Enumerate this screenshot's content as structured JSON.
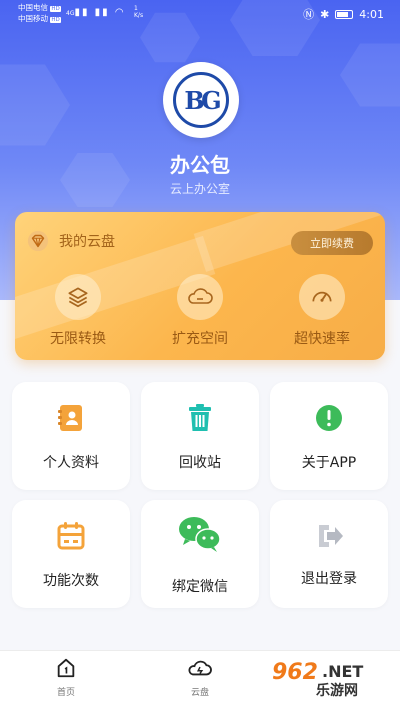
{
  "status_bar": {
    "carrier1": "中国电信",
    "carrier2": "中国移动",
    "net_badge": "HD",
    "net_type": "4G",
    "rate_top": "1",
    "rate_unit": "K/s",
    "time": "4:01",
    "battery_icon": "battery-icon"
  },
  "profile": {
    "logo_text": "BG",
    "app_name": "办公包",
    "subtitle": "云上办公室"
  },
  "vip_card": {
    "title": "我的云盘",
    "renew_label": "立即续费",
    "features": [
      {
        "label": "无限转换",
        "icon": "layers-icon"
      },
      {
        "label": "扩充空间",
        "icon": "cloud-icon"
      },
      {
        "label": "超快速率",
        "icon": "speedometer-icon"
      }
    ],
    "colors": {
      "gold": "#fcb64d",
      "text": "#9a5a14"
    }
  },
  "tiles": [
    {
      "label": "个人资料",
      "icon": "contacts-book-icon"
    },
    {
      "label": "回收站",
      "icon": "trash-icon"
    },
    {
      "label": "关于APP",
      "icon": "info-icon"
    },
    {
      "label": "功能次数",
      "icon": "calendar-icon"
    },
    {
      "label": "绑定微信",
      "icon": "wechat-icon"
    },
    {
      "label": "退出登录",
      "icon": "logout-icon"
    }
  ],
  "bottom_nav": {
    "items": [
      {
        "label": "首页",
        "icon": "home-icon"
      },
      {
        "label": "云盘",
        "icon": "cloud-disk-icon"
      }
    ]
  },
  "watermark": {
    "number": "962",
    "suffix": ".NET",
    "site": "乐游网"
  },
  "colors": {
    "header": "#4a64f1",
    "accent_orange": "#f4a33a",
    "teal": "#1fbfb0",
    "green": "#3dbb5a"
  }
}
